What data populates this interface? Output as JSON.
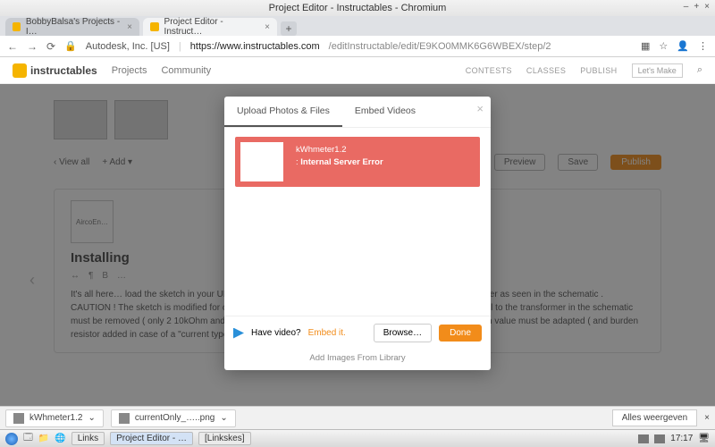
{
  "os": {
    "window_title": "Project Editor - Instructables - Chromium",
    "min": "–",
    "max": "+",
    "close": "×"
  },
  "browser": {
    "tabs": [
      {
        "title": "BobbyBalsa's Projects - I…"
      },
      {
        "title": "Project Editor - Instruct…"
      }
    ],
    "newtab": "+",
    "nav": {
      "back": "←",
      "fwd": "→",
      "reload": "⟳"
    },
    "url": {
      "lock_label": "Autodesk, Inc. [US]",
      "host": "https://www.instructables.com",
      "path": "/editInstructable/edit/E9KO0MMK6G6WBEX/step/2"
    }
  },
  "site": {
    "brand": "instructables",
    "nav": [
      "Projects",
      "Community"
    ],
    "rnav": [
      "CONTESTS",
      "CLASSES",
      "PUBLISH"
    ],
    "login": "Let's Make",
    "search_icon": "⌕"
  },
  "editor": {
    "toolbar": {
      "viewall": "‹ View all",
      "add": "+ Add ▾",
      "preview": "Preview",
      "save": "Save",
      "publish": "Publish"
    },
    "step": {
      "thumb_label": "AircoEn…",
      "title": "Installing",
      "format_items": [
        "↔",
        "¶",
        "B",
        "…"
      ],
      "body": "It's all here…\nload the sketch in your UNO/Nano and connect the resistors/capacitor and current transformer as seen in the schematic . CAUTION ! The sketch is modified for current transformer Part Number SCT 013-050 . The resistor parallel to the transformer in the schematic must be removed ( only 2 10kOhm and capacitor needed ) . Other CT's may be used but sketch calibration value must be adapted ( and burden resistor added in case of a \"current type\")",
      "arrow": "‹"
    }
  },
  "modal": {
    "close": "×",
    "tabs": [
      "Upload Photos & Files",
      "Embed Videos"
    ],
    "upload": {
      "filename": "kWhmeter1.2",
      "error_prefix": ": ",
      "error": "Internal Server Error"
    },
    "footer": {
      "prompt": "Have video? ",
      "embed": "Embed it.",
      "browse": "Browse…",
      "done": "Done"
    },
    "lib": "Add Images From Library"
  },
  "downloads": {
    "items": [
      {
        "name": "kWhmeter1.2"
      },
      {
        "name": "currentOnly_…..png"
      }
    ],
    "showall": "Alles weergeven"
  },
  "taskbar": {
    "items": [
      {
        "label": "Links",
        "active": false
      },
      {
        "label": "Project Editor - …",
        "active": true
      },
      {
        "label": "[Linkskes]",
        "active": false
      }
    ],
    "clock": "17:17"
  }
}
